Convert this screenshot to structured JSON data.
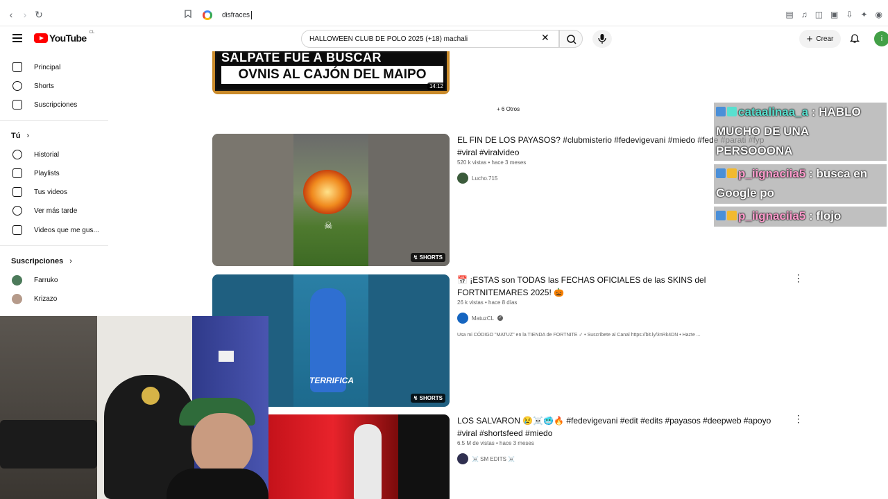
{
  "browser": {
    "address_text": "disfraces"
  },
  "header": {
    "logo_text": "YouTube",
    "country_code": "CL",
    "search_value": "HALLOWEEN CLUB DE POLO 2025 (+18) machali",
    "create_label": "Crear",
    "avatar_letter": "i"
  },
  "sidebar": {
    "main_items": [
      {
        "label": "Principal",
        "icon": "home-icon"
      },
      {
        "label": "Shorts",
        "icon": "shorts-icon"
      },
      {
        "label": "Suscripciones",
        "icon": "subscriptions-icon"
      }
    ],
    "you_heading": "Tú",
    "you_items": [
      {
        "label": "Historial",
        "icon": "history-icon"
      },
      {
        "label": "Playlists",
        "icon": "playlists-icon"
      },
      {
        "label": "Tus videos",
        "icon": "your-videos-icon"
      },
      {
        "label": "Ver más tarde",
        "icon": "watch-later-icon"
      },
      {
        "label": "Videos que me gus...",
        "icon": "liked-icon"
      }
    ],
    "subs_heading": "Suscripciones",
    "subscriptions": [
      {
        "label": "Farruko",
        "color": "#4c7a5a"
      },
      {
        "label": "Krizazo",
        "color": "#b59a8a"
      }
    ]
  },
  "top_video": {
    "line1": "SALPATE FUE A BUSCAR",
    "line2": "OVNIS AL CAJÓN DEL MAIPO",
    "duration": "14:12",
    "more_others": "+ 6 Otros"
  },
  "videos": [
    {
      "title": "EL FIN DE LOS PAYASOS? #clubmisterio #fedevigevani #miedo #fede #parati #fyp #viral #viralvideo",
      "meta": "520 k vistas • hace 3 meses",
      "channel": "Lucho.715",
      "badge": "SHORTS",
      "avatar_color": "#3b5b3b"
    },
    {
      "title": "📅 ¡ESTAS son TODAS las FECHAS OFICIALES de las SKINS del FORTNITEMARES 2025! 🎃",
      "meta": "26 k vistas • hace 8 días",
      "channel": "MatuzCL",
      "description": "Usa mi CÓDIGO \"MATUZ\" en la TIENDA de FORTNITE ✓ • Suscríbete al Canal https://bit.ly/3nRk4DN • Hazte ...",
      "badge": "SHORTS",
      "thumb_caption": "TERRIFICA",
      "avatar_color": "#1565c0"
    },
    {
      "title": "LOS SALVARON 😢☠️🥶🔥 #fedevigevani #edit #edits #payasos #deepweb #apoyo #viral #shortsfeed #miedo",
      "meta": "6.5 M de vistas • hace 3 meses",
      "channel": "☠️ SM EDITS ☠️",
      "avatar_color": "#303050"
    }
  ],
  "chat": [
    {
      "user": "cataalinaa_a",
      "text": " : HABLO MUCHO DE UNA PERSOOONA"
    },
    {
      "user": "p_iignaciia5",
      "text": " : busca en Google po"
    },
    {
      "user": "p_iignaciia5",
      "text": " : flojo"
    }
  ],
  "colors": {
    "accent_red": "#ff0000",
    "chat_user_teal": "#58e0cf",
    "chat_user_pink": "#ff9ccd"
  }
}
